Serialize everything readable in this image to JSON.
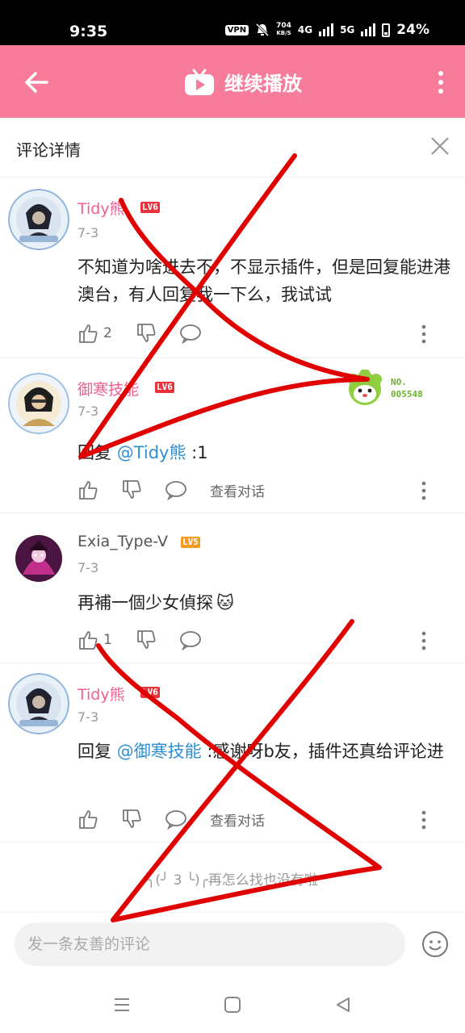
{
  "status": {
    "time": "9:35",
    "vpn": "VPN",
    "speed_value": "704",
    "speed_unit": "KB/S",
    "net1": "4G",
    "net2": "5G",
    "battery": "24%"
  },
  "header": {
    "title": "继续播放",
    "icon": "tv-play-icon"
  },
  "detail": {
    "title": "评论详情"
  },
  "colors": {
    "accent": "#f77c9c",
    "username_vip": "#f25d8e",
    "mention": "#2f8fd0",
    "lv6": "#e8333d",
    "lv5": "#f59a23",
    "annotation": "#e00000"
  },
  "comments": [
    {
      "username": "Tidy熊",
      "level": "LV6",
      "date": "7-3",
      "text": "不知道为啥进去不，不显示插件，但是回复能进港澳台，有人回复我一下么，我试试",
      "likes": "2",
      "reply_to": ""
    },
    {
      "username": "御寒技能",
      "level": "LV6",
      "date": "7-3",
      "prefix": "回复 ",
      "mention": "@Tidy熊",
      "text": " :1",
      "view_conversation": "查看对话",
      "badge": "NO.\n005548"
    },
    {
      "username": "Exia_Type-V",
      "level": "LV5",
      "date": "7-3",
      "text": "再補一個少女偵探",
      "emoji": "🐱",
      "likes": "1"
    },
    {
      "username": "Tidy熊",
      "level": "LV6",
      "date": "7-3",
      "prefix": "回复 ",
      "mention": "@御寒技能",
      "text": " :感谢呀b友，插件还真给评论进",
      "view_conversation": "查看对话"
    }
  ],
  "end_note": "(╯‵□′)╯再怎么找也没有啦",
  "end_note_display": "╮(╯ 3 ╰)╭再怎么找也没有啦",
  "input": {
    "placeholder": "发一条友善的评论"
  }
}
